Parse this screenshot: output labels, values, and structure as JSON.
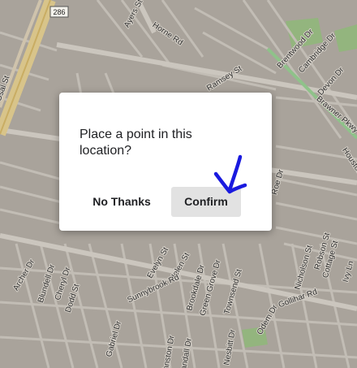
{
  "map": {
    "route_shield": "286",
    "streets": [
      "Ayers St",
      "Horne Rd",
      "Brentwood Dr",
      "Cambridge Dr",
      "Devon Dr",
      "Ramsey St",
      "Brawner Pkwy",
      "Houston",
      "Osal St",
      "Archer Dr",
      "Blundell Dr",
      "Cheryl Dr",
      "Dodd St",
      "Evelyn St",
      "Helen St",
      "Brookdale Dr",
      "Green Grove Dr",
      "Townsend St",
      "Sunnybrook Rd",
      "Gabriel Dr",
      "Johnston Dr",
      "Randall Dr",
      "Nesbitt Dr",
      "Odem Dr",
      "Gollihar Rd",
      "Nicholson St",
      "Robson St",
      "Cottage St",
      "Ivy Ln",
      "Roe Dr"
    ]
  },
  "dialog": {
    "message": "Place a point in this location?",
    "no_thanks_label": "No Thanks",
    "confirm_label": "Confirm"
  },
  "annotation": {
    "icon": "hand-drawn-arrow-icon",
    "color": "#1a1adf"
  },
  "colors": {
    "map_background": "#a9a39b",
    "road": "#c7c2ba",
    "highway": "#d8c48a",
    "park": "#93b57e",
    "arrow": "#1a1adf"
  }
}
